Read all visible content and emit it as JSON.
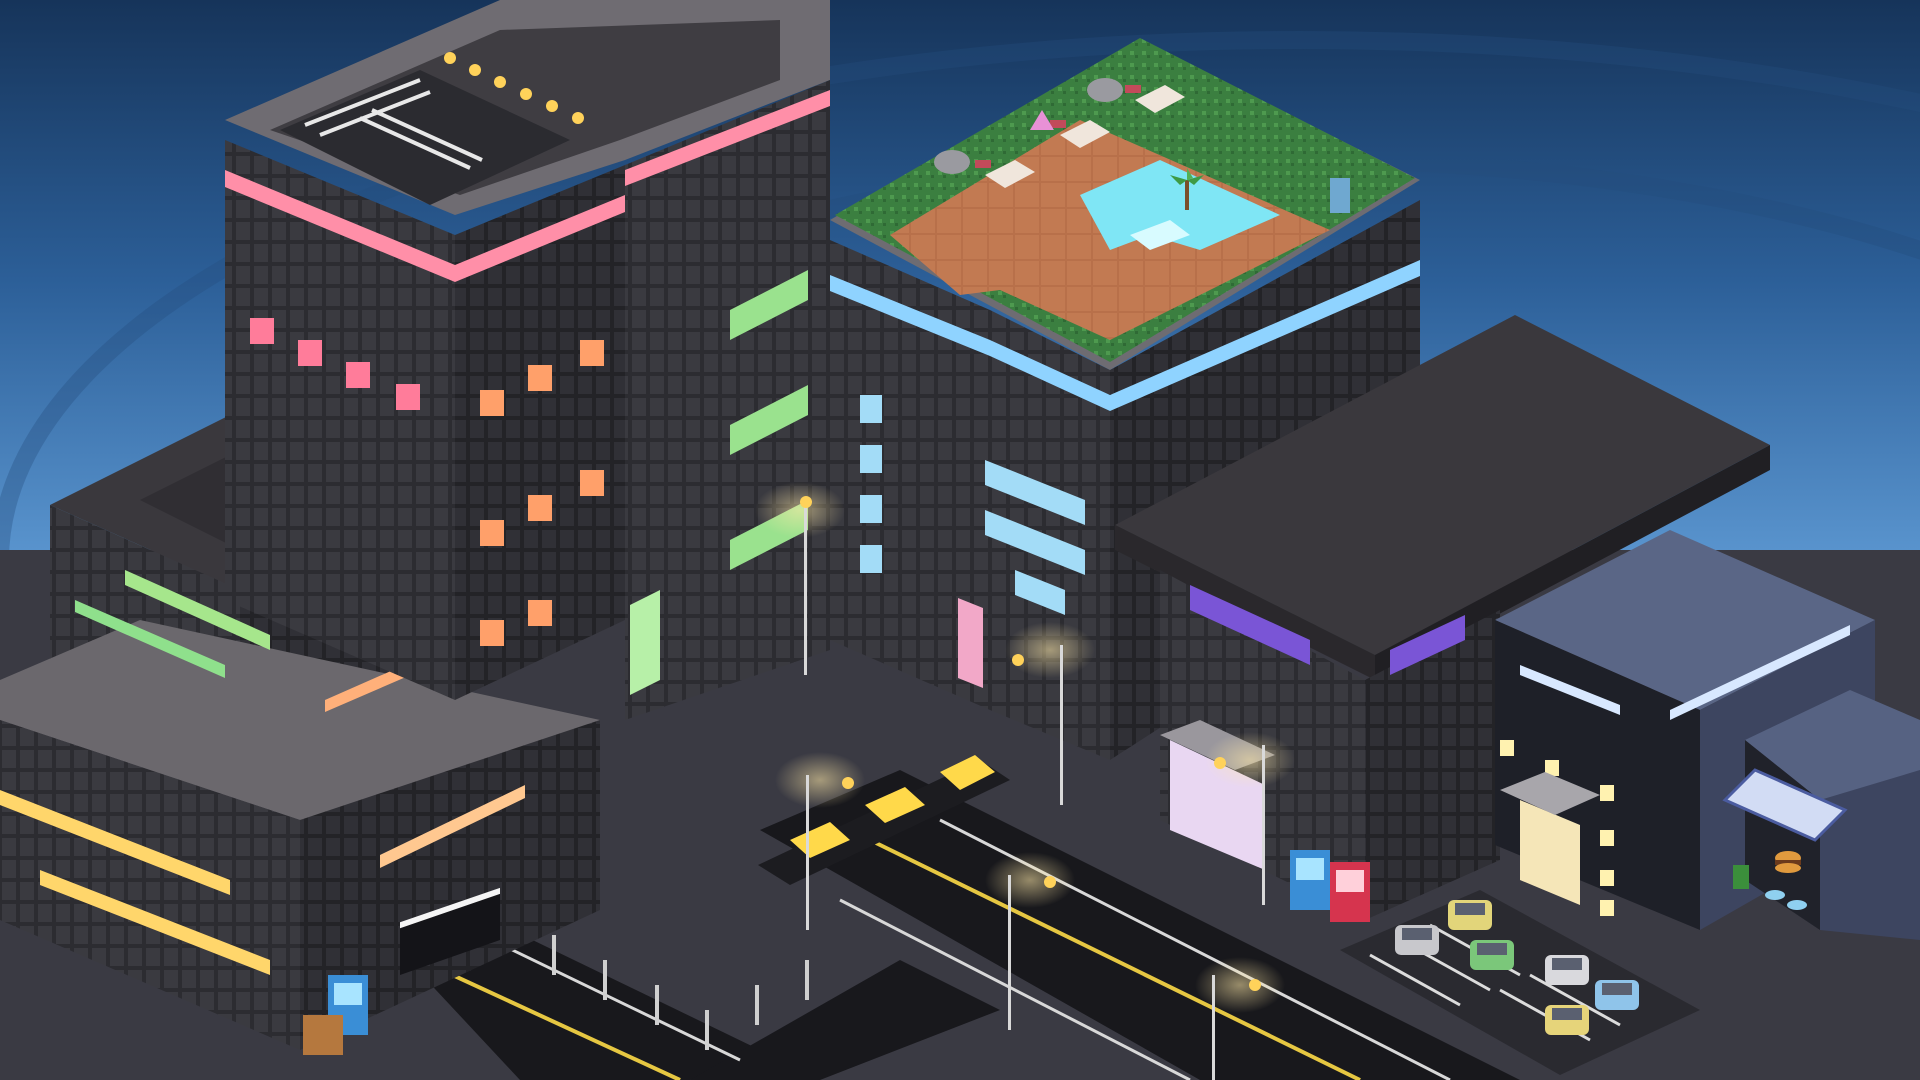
{
  "scene": {
    "description_free": true,
    "colors": {
      "sky_top": "#16345a",
      "sky_mid": "#2c5f98",
      "sky_horizon": "#5a95cf",
      "ground": "#3b3b44",
      "road": "#17171b",
      "building_dark": "#2a2a2e",
      "building_roof": "#6d6a70",
      "neon_pink": "#ff8aa8",
      "neon_blue": "#8fd3ff",
      "neon_green": "#8fe08c",
      "neon_orange": "#ffae78",
      "neon_purple": "#7a55d6",
      "lamp_yellow": "#ffd25a",
      "pool_water": "#7fe6f5",
      "garden_green": "#3f8a45",
      "deck_brown": "#b46a45"
    },
    "icons": [
      "helipad-icon",
      "pool-icon",
      "palm-tree-icon",
      "vending-machine-icon",
      "street-lamp-icon",
      "car-icon",
      "barrier-icon",
      "trash-bin-icon",
      "cafe-awning-icon",
      "burger-sign-icon",
      "helipad-letter-icon"
    ]
  }
}
